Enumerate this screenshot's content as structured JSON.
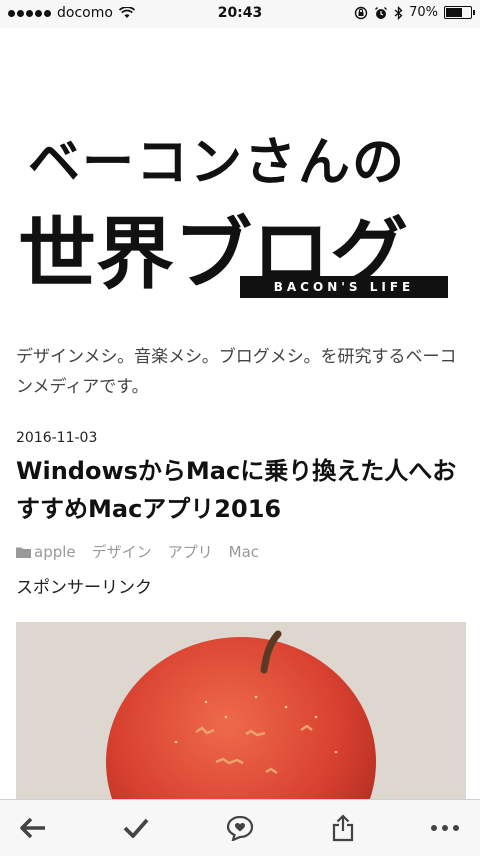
{
  "status_bar": {
    "carrier": "docomo",
    "time": "20:43",
    "battery": "70%",
    "battery_level": 0.7
  },
  "blog": {
    "logo_line1": "ベーコンさんの",
    "logo_line2": "世界ブログ",
    "logo_tagline": "BACON'S LIFE",
    "description": "デザインメシ。音楽メシ。ブログメシ。を研究するベーコンメディアです。"
  },
  "post": {
    "date": "2016-11-03",
    "title": "WindowsからMacに乗り換えた人へおすすめMacアプリ2016",
    "tags": [
      "apple",
      "デザイン",
      "アプリ",
      "Mac"
    ],
    "sponsor_label": "スポンサーリンク",
    "image_subject": "apple-photo"
  },
  "toolbar": {
    "icons": [
      "back-arrow-icon",
      "check-icon",
      "comment-icon",
      "share-icon",
      "more-icon"
    ]
  },
  "colors": {
    "tag_text": "#999999",
    "apple_red": "#d8402f",
    "photo_background": "#ddd7cf"
  }
}
